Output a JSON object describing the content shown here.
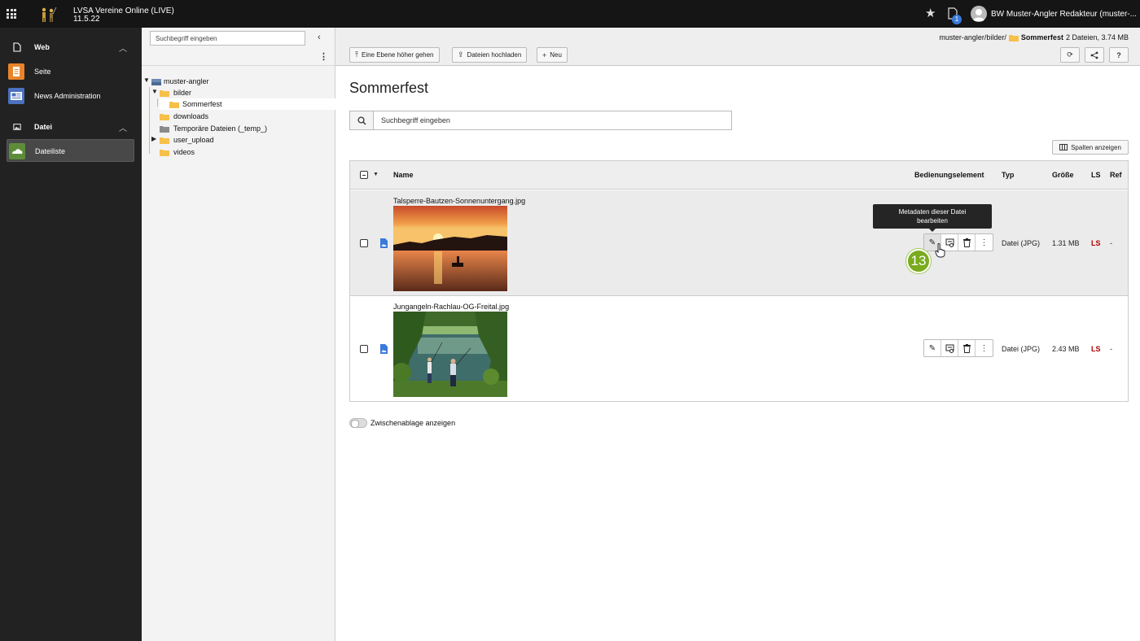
{
  "topbar": {
    "site_name": "LVSA Vereine Online (LIVE)",
    "version": "11.5.22",
    "notification_count": "1",
    "user_label": "BW Muster-Angler Redakteur (muster-..."
  },
  "modules": {
    "web_group": "Web",
    "page_item": "Seite",
    "news_item": "News Administration",
    "file_group": "Datei",
    "filelist_item": "Dateiliste"
  },
  "tree": {
    "search_placeholder": "Suchbegriff eingeben",
    "root": "muster-angler",
    "bilder": "bilder",
    "sommerfest": "Sommerfest",
    "downloads": "downloads",
    "temp": "Temporäre Dateien (_temp_)",
    "user_upload": "user_upload",
    "videos": "videos"
  },
  "header": {
    "path_prefix": "muster-angler/bilder/",
    "path_current": "Sommerfest",
    "path_info": "2 Dateien, 3.74 MB",
    "btn_up": "Eine Ebene höher gehen",
    "btn_upload": "Dateien hochladen",
    "btn_new": "Neu"
  },
  "main": {
    "title": "Sommerfest",
    "search_placeholder": "Suchbegriff eingeben",
    "columns_button": "Spalten anzeigen",
    "clipboard_toggle": "Zwischenablage anzeigen"
  },
  "table": {
    "columns": [
      "Name",
      "Bedienungselement",
      "Typ",
      "Größe",
      "LS",
      "Ref"
    ],
    "rows": [
      {
        "name": "Talsperre-Bautzen-Sonnenuntergang.jpg",
        "type": "Datei (JPG)",
        "size": "1.31 MB",
        "ls": "LS",
        "ref": "-"
      },
      {
        "name": "Jungangeln-Rachlau-OG-Freital.jpg",
        "type": "Datei (JPG)",
        "size": "2.43 MB",
        "ls": "LS",
        "ref": "-"
      }
    ]
  },
  "tooltip": {
    "line1": "Metadaten dieser Datei",
    "line2": "bearbeiten"
  },
  "step_badge": "13",
  "colors": {
    "topbar": "#151515",
    "module_menu": "#222222",
    "accent_orange": "#e8852a",
    "accent_blue": "#4a72c0",
    "accent_green": "#5e8d3a",
    "step_badge": "#7aab1f",
    "ls_red": "#b00000"
  }
}
